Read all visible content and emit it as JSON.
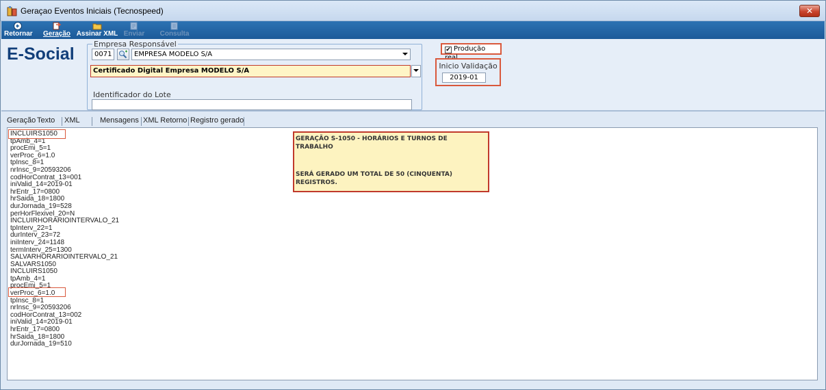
{
  "window": {
    "title": "Geraçao Eventos Iniciais (Tecnospeed)",
    "close_symbol": "✕"
  },
  "toolbar": {
    "retornar": "Retornar",
    "geracao": "Geração",
    "assinar": "Assinar XML",
    "enviar": "Enviar",
    "consulta": "Consulta"
  },
  "brand": "E-Social",
  "empresa": {
    "group_label": "Empresa Responsável",
    "code": "0071",
    "name": "EMPRESA MODELO S/A",
    "certificado": "Certificado Digital Empresa MODELO S/A",
    "lote_label": "Identificador do Lote",
    "lote_value": ""
  },
  "producao": {
    "label": "Produção real",
    "checked": "✔"
  },
  "validacao": {
    "label": "Inicio Validação",
    "value": "2019-01"
  },
  "tabs": [
    "Geração",
    "Texto",
    "XML",
    "Mensagens",
    "XML Retorno",
    "Registro gerado"
  ],
  "text_lines": [
    "INCLUIRS1050",
    "tpAmb_4=1",
    "procEmi_5=1",
    "verProc_6=1.0",
    "tpInsc_8=1",
    "nrInsc_9=20593206",
    "codHorContrat_13=001",
    "iniValid_14=2019-01",
    "hrEntr_17=0800",
    "hrSaida_18=1800",
    "durJornada_19=528",
    "perHorFlexivel_20=N",
    "INCLUIRHORARIOINTERVALO_21",
    "tpInterv_22=1",
    "durInterv_23=72",
    "iniInterv_24=1148",
    "termInterv_25=1300",
    "SALVARHORARIOINTERVALO_21",
    "SALVARS1050",
    "INCLUIRS1050",
    "tpAmb_4=1",
    "procEmi_5=1",
    "verProc_6=1.0",
    "tpInsc_8=1",
    "nrInsc_9=20593206",
    "codHorContrat_13=002",
    "iniValid_14=2019-01",
    "hrEntr_17=0800",
    "hrSaida_18=1800",
    "durJornada_19=510"
  ],
  "notice": {
    "line1": "GERAÇÃO S-1050 - HORÁRIOS E TURNOS DE TRABALHO",
    "line2": "SERÁ GERADO UM TOTAL DE 50 (CINQUENTA) REGISTROS."
  },
  "colors": {
    "toolbar": "#1c5a99",
    "highlight": "#d9583b",
    "notice_bg": "#fdf3c0",
    "brand": "#123f7a"
  }
}
